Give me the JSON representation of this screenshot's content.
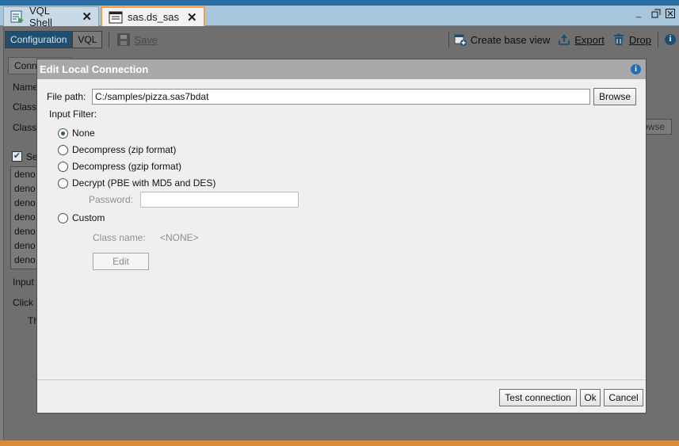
{
  "tabs": [
    {
      "label": "VQL Shell",
      "icon": "vql-shell-icon"
    },
    {
      "label": "sas.ds_sas",
      "icon": "datasource-icon"
    }
  ],
  "window_controls": {
    "minimize": "_",
    "restore": "▫",
    "close": "×"
  },
  "toolbar": {
    "configuration": "Configuration",
    "vql": "VQL",
    "save": "Save",
    "create_base_view": "Create base view",
    "export": "Export",
    "drop": "Drop"
  },
  "background": {
    "tab_label": "Conn",
    "labels": [
      "Name",
      "Class",
      "Class",
      "Se",
      "Input",
      "Click",
      "Th"
    ],
    "list_items": [
      "deno",
      "deno",
      "deno",
      "deno",
      "deno",
      "deno",
      "deno"
    ],
    "browse": "owse"
  },
  "dialog": {
    "title": "Edit Local Connection",
    "file_path_label": "File path:",
    "file_path_value": "C:/samples/pizza.sas7bdat",
    "browse_label": "Browse",
    "input_filter_label": "Input Filter:",
    "options": [
      {
        "label": "None",
        "checked": true
      },
      {
        "label": "Decompress (zip format)",
        "checked": false
      },
      {
        "label": "Decompress (gzip format)",
        "checked": false
      },
      {
        "label": "Decrypt (PBE with MD5 and DES)",
        "checked": false
      },
      {
        "label": "Custom",
        "checked": false
      }
    ],
    "password_label": "Password:",
    "password_value": "",
    "class_name_label": "Class name:",
    "class_name_value": "<NONE>",
    "edit_label": "Edit",
    "test_connection_label": "Test connection",
    "ok_label": "Ok",
    "cancel_label": "Cancel"
  },
  "colors": {
    "accent": "#f0a040",
    "title_bar": "#2a6ea6",
    "selected_tab": "#1f4f70",
    "info": "#1f6fb4"
  }
}
